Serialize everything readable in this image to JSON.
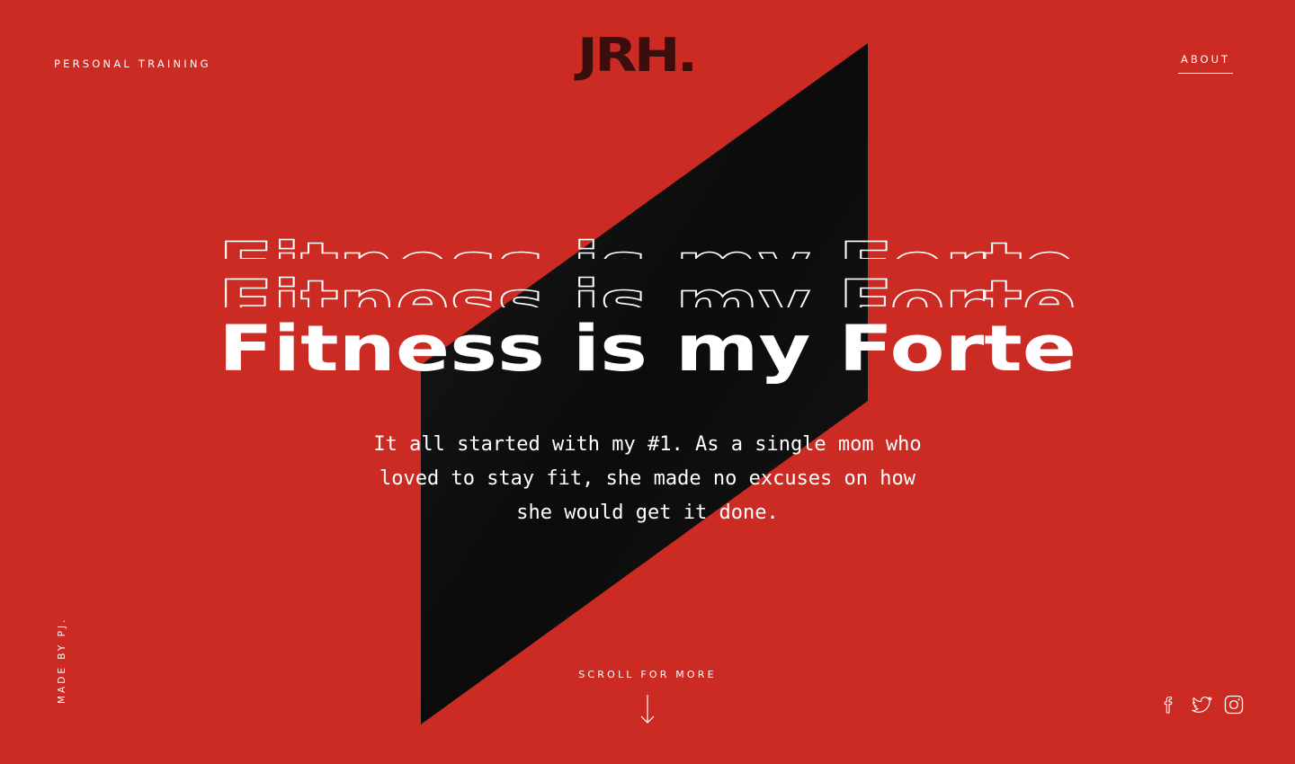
{
  "brand": {
    "logo_text": "JRH.",
    "logo_color": "#3a0e0c"
  },
  "nav": {
    "left_label": "PERSONAL TRAINING",
    "right_label": "ABOUT"
  },
  "hero": {
    "headline": "Fitness is my Forte",
    "intro": "It all started with my #1. As a single mom who loved to stay fit, she made no excuses on how she would get it done."
  },
  "scroll": {
    "label": "SCROLL FOR MORE",
    "icon": "arrow-down-icon"
  },
  "credit": {
    "text": "MADE BY PJ."
  },
  "social": [
    {
      "name": "facebook",
      "icon": "facebook-icon"
    },
    {
      "name": "twitter",
      "icon": "twitter-icon"
    },
    {
      "name": "instagram",
      "icon": "instagram-icon"
    }
  ],
  "colors": {
    "background": "#cc2b23",
    "shape": "#0d0d0d",
    "text": "#ffffff"
  }
}
